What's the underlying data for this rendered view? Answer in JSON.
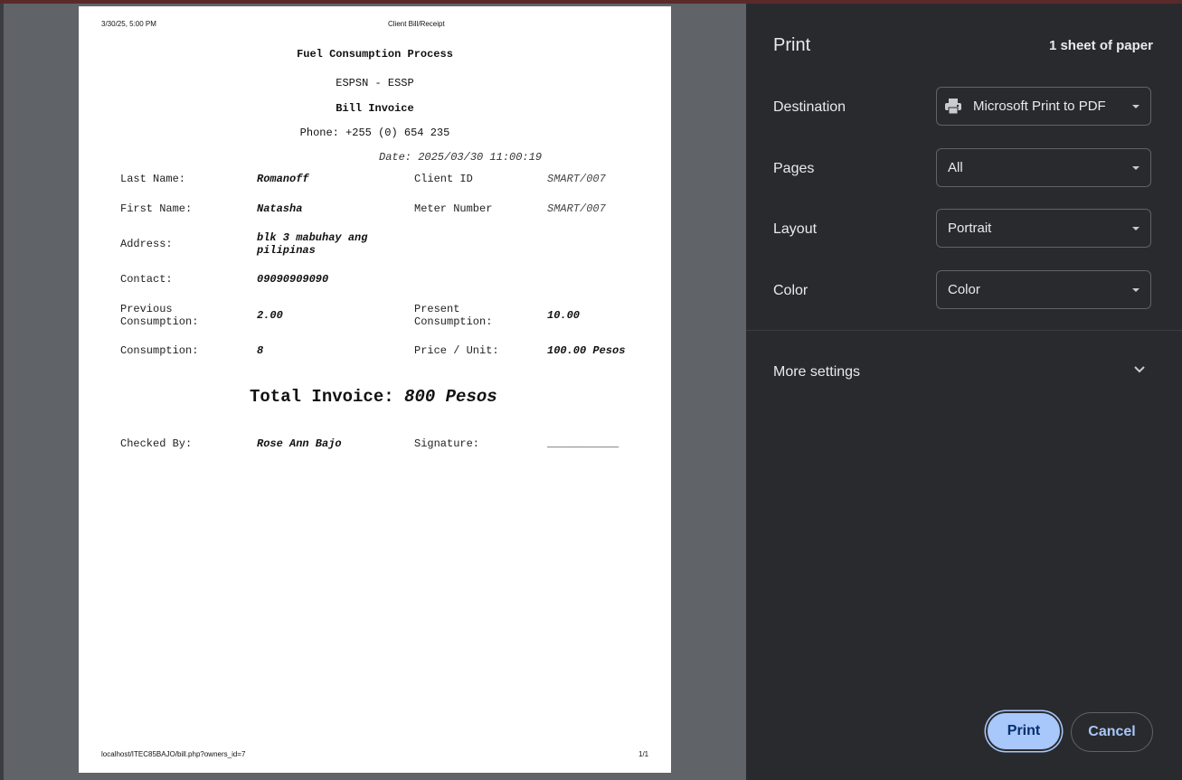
{
  "page": {
    "header_datetime": "3/30/25, 5:00 PM",
    "header_title": "Client Bill/Receipt",
    "footer_url": "localhost/ITEC85BAJO/bill.php?owners_id=7",
    "footer_pages": "1/1"
  },
  "invoice": {
    "title": "Fuel Consumption Process",
    "org": "ESPSN - ESSP",
    "doc_type": "Bill Invoice",
    "phone": "Phone: +255 (0) 654 235",
    "date": "Date: 2025/03/30 11:00:19",
    "fields": {
      "last_name_label": "Last Name:",
      "last_name": "Romanoff",
      "client_id_label": "Client ID",
      "client_id": "SMART/007",
      "first_name_label": "First Name:",
      "first_name": "Natasha",
      "meter_label": "Meter Number",
      "meter": "SMART/007",
      "address_label": "Address:",
      "address_line1": "blk 3 mabuhay ang",
      "address_line2": "pilipinas",
      "contact_label": "Contact:",
      "contact": "09090909090",
      "prev_label_1": "Previous",
      "prev_label_2": "Consumption:",
      "prev": "2.00",
      "present_label_1": "Present",
      "present_label_2": "Consumption:",
      "present": "10.00",
      "consumption_label": "Consumption:",
      "consumption": "8",
      "price_label": "Price / Unit:",
      "price": "100.00 Pesos",
      "checked_label": "Checked By:",
      "checked": "Rose Ann Bajo",
      "signature_label": "Signature:",
      "signature_line": "___________"
    },
    "total_label": "Total Invoice:",
    "total_value": "800 Pesos"
  },
  "print_panel": {
    "title": "Print",
    "sheets": "1 sheet of paper",
    "destination_label": "Destination",
    "destination_value": "Microsoft Print to PDF",
    "pages_label": "Pages",
    "pages_value": "All",
    "layout_label": "Layout",
    "layout_value": "Portrait",
    "color_label": "Color",
    "color_value": "Color",
    "more_settings": "More settings",
    "print_button": "Print",
    "cancel_button": "Cancel"
  },
  "icons": {
    "destination": "printer-icon",
    "more": "chevron-down-icon"
  },
  "colors": {
    "panel_bg": "#292a2d",
    "preview_bg": "#606368",
    "accent": "#a8c7fa"
  }
}
